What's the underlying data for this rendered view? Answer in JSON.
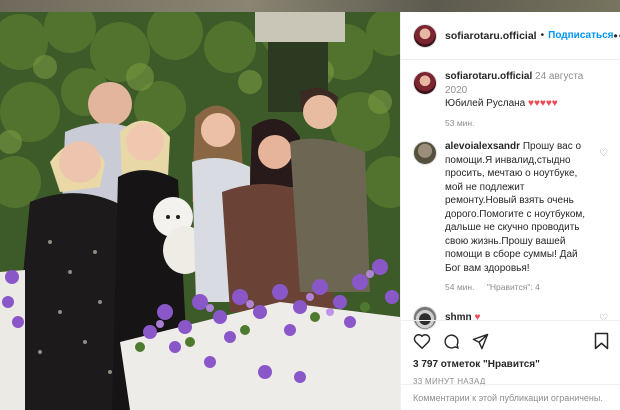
{
  "post": {
    "photo_alt": "Family photo",
    "header": {
      "username": "sofiarotaru.official",
      "separator": "•",
      "follow_label": "Подписаться",
      "more": "•••"
    },
    "caption": {
      "username": "sofiarotaru.official",
      "date": "24 августа 2020",
      "text": "Юбилей Руслана",
      "hearts": "♥♥♥♥♥",
      "time": "53 мин."
    },
    "comments": [
      {
        "username": "alevoialexsandr",
        "text": "Прошу вас о помощи.Я инвалид,стыдно просить, мечтаю о ноутбуке, мой не подлежит ремонту.Новый взять очень дорого.Помогите с ноутбуком, дальше не скучно проводить свою жизнь.Прошу вашей помощи в сборе суммы! Дай Бог вам здоровья!",
        "time": "54 мин.",
        "likes": "\"Нравится\": 4"
      },
      {
        "username": "shmn",
        "text": "♥"
      }
    ],
    "likes_text": "3 797 отметок \"Нравится\"",
    "posted_ago": "33 МИНУТ НАЗАД",
    "comments_disabled": "Комментарии к этой публикации ограничены."
  }
}
